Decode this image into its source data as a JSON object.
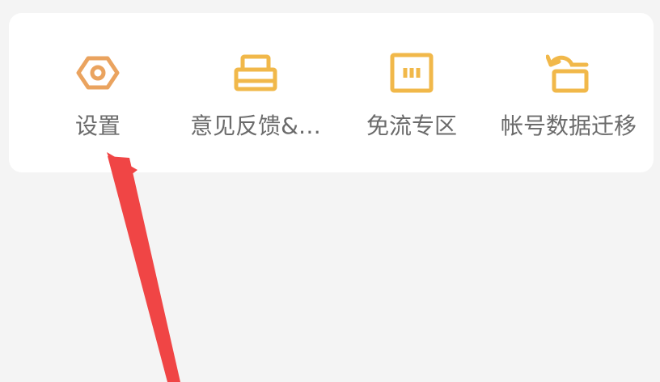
{
  "shortcuts": {
    "items": [
      {
        "label": "设置",
        "icon": "settings-hexagon-icon"
      },
      {
        "label": "意见反馈&…",
        "icon": "feedback-tray-icon"
      },
      {
        "label": "免流专区",
        "icon": "data-free-zone-icon"
      },
      {
        "label": "帐号数据迁移",
        "icon": "account-migration-icon"
      }
    ]
  },
  "colors": {
    "background": "#f4f4f4",
    "card": "#ffffff",
    "icon_gold": "#f1b84a",
    "icon_orange": "#e9a25f",
    "label_gray": "#6b6b6b",
    "annotation_arrow": "#f04545"
  }
}
